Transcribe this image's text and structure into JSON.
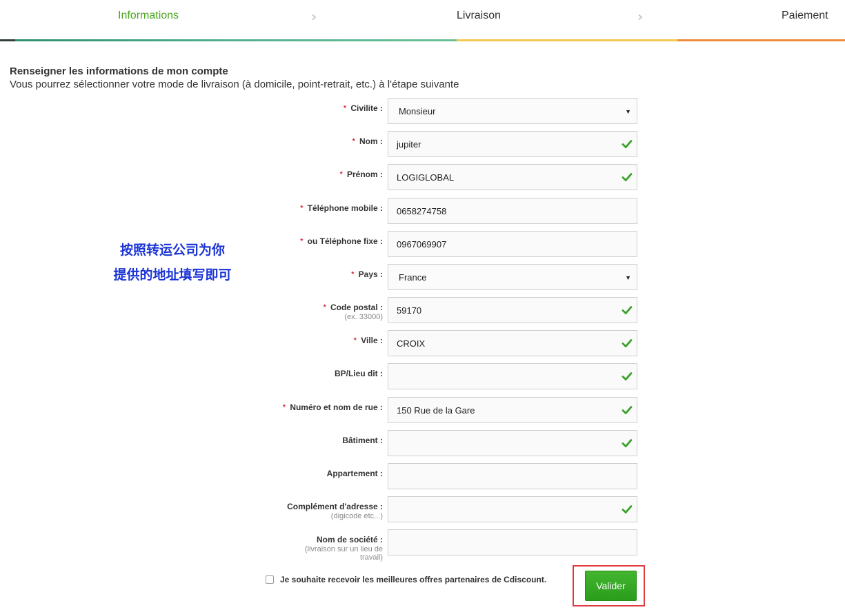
{
  "steps": [
    {
      "label": "Informations",
      "active": true
    },
    {
      "label": "Livraison",
      "active": false
    },
    {
      "label": "Paiement",
      "active": false
    }
  ],
  "colors": {
    "active_step": "#4aa51d",
    "required": "#d0021b",
    "check": "#3aa22a",
    "button": "#2fa321",
    "annotation": "#1a33d6",
    "highlight_frame": "#e0393e"
  },
  "intro": {
    "title": "Renseigner les informations de mon compte",
    "subtitle": "Vous pourrez sélectionner votre mode de livraison (à domicile, point-retrait, etc.) à l'étape suivante"
  },
  "annotation": {
    "line1": "按照转运公司为你",
    "line2": "提供的地址填写即可"
  },
  "form": {
    "required_mark": "*",
    "fields": [
      {
        "label": "Civilite :",
        "value": "Monsieur",
        "required": true,
        "type": "select",
        "valid": false
      },
      {
        "label": "Nom :",
        "value": "jupiter",
        "required": true,
        "type": "text",
        "valid": true
      },
      {
        "label": "Prénom :",
        "value": "LOGIGLOBAL",
        "required": true,
        "type": "text",
        "valid": true
      },
      {
        "label": "Téléphone mobile :",
        "value": "0658274758",
        "required": true,
        "type": "text",
        "valid": false
      },
      {
        "label": "ou Téléphone fixe :",
        "value": "0967069907",
        "required": true,
        "type": "text",
        "valid": false
      },
      {
        "label": "Pays :",
        "value": "France",
        "required": true,
        "type": "select",
        "valid": false
      },
      {
        "label": "Code postal :",
        "hint": "(ex. 33000)",
        "value": "59170",
        "required": true,
        "type": "text",
        "valid": true
      },
      {
        "label": "Ville :",
        "value": "CROIX",
        "required": true,
        "type": "text",
        "valid": true
      },
      {
        "label": "BP/Lieu dit :",
        "value": "",
        "required": false,
        "type": "text",
        "valid": true
      },
      {
        "label": "Numéro et nom de rue :",
        "value": "150 Rue de la Gare",
        "required": true,
        "type": "text",
        "valid": true
      },
      {
        "label": "Bâtiment :",
        "value": "",
        "required": false,
        "type": "text",
        "valid": true
      },
      {
        "label": "Appartement :",
        "value": "",
        "required": false,
        "type": "text",
        "valid": false
      },
      {
        "label": "Complément d'adresse :",
        "hint": "(digicode etc...)",
        "value": "",
        "required": false,
        "type": "text",
        "valid": true
      },
      {
        "label": "Nom de société :",
        "hint_lines": [
          "(livraison sur un lieu de",
          "travail)"
        ],
        "value": "",
        "required": false,
        "type": "text",
        "valid": false
      }
    ]
  },
  "optin": {
    "label": "Je souhaite recevoir les meilleures offres partenaires de Cdiscount.",
    "checked": false
  },
  "submit": {
    "label": "Valider"
  }
}
